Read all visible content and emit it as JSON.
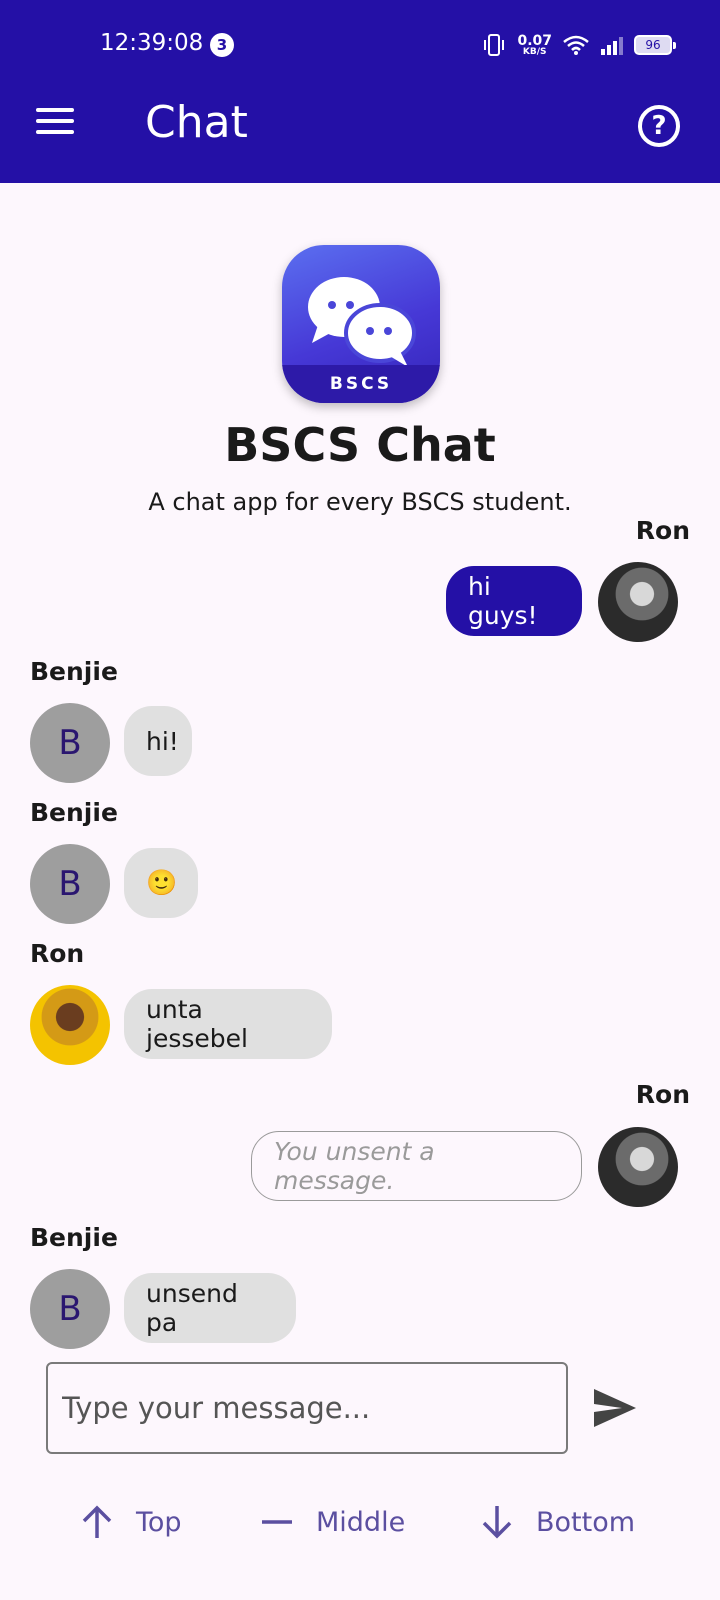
{
  "status": {
    "time": "12:39:08",
    "notification_count": "3",
    "net_speed_value": "0.07",
    "net_speed_unit": "KB/S",
    "battery": "96"
  },
  "appbar": {
    "title": "Chat",
    "menu_icon": "hamburger-menu-icon",
    "help_icon": "help-circle-icon"
  },
  "intro": {
    "logo_text": "BSCS",
    "title": "BSCS Chat",
    "subtitle": "A chat app for every BSCS student."
  },
  "messages": [
    {
      "sender": "Ron",
      "text": "hi guys!",
      "side": "right",
      "avatar": "photo"
    },
    {
      "sender": "Benjie",
      "text": "hi!",
      "side": "left",
      "avatar_letter": "B"
    },
    {
      "sender": "Benjie",
      "text": "🙂",
      "side": "left",
      "avatar_letter": "B"
    },
    {
      "sender": "Ron",
      "text": "unta jessebel",
      "side": "left",
      "avatar": "photo"
    },
    {
      "sender": "Ron",
      "text": "You unsent a message.",
      "side": "right",
      "avatar": "photo",
      "unsent": true
    },
    {
      "sender": "Benjie",
      "text": "unsend pa",
      "side": "left",
      "avatar_letter": "B"
    }
  ],
  "composer": {
    "placeholder": "Type your message...",
    "send_icon": "send-icon"
  },
  "bottom_nav": [
    {
      "label": "Top",
      "icon": "arrow-up-icon"
    },
    {
      "label": "Middle",
      "icon": "minus-icon"
    },
    {
      "label": "Bottom",
      "icon": "arrow-down-icon"
    }
  ],
  "colors": {
    "primary": "#2410a6",
    "background": "#fdf7fd",
    "received_bubble": "#e0e0e0",
    "nav_accent": "#5b4fa0"
  }
}
